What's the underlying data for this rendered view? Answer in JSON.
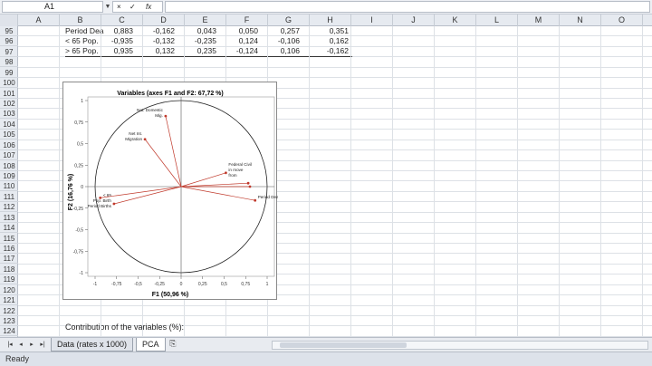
{
  "formula_bar": {
    "name_box": "A1",
    "name_dropdown_icon": "chevron-down-icon",
    "cancel_glyph": "×",
    "enter_glyph": "✓",
    "fx_label": "fx",
    "formula": ""
  },
  "columns": [
    "A",
    "B",
    "C",
    "D",
    "E",
    "F",
    "G",
    "H",
    "I",
    "J",
    "K",
    "L",
    "M",
    "N",
    "O"
  ],
  "rows": [
    "95",
    "96",
    "97",
    "98",
    "99",
    "100",
    "101",
    "102",
    "103",
    "104",
    "105",
    "106",
    "107",
    "108",
    "109",
    "110",
    "111",
    "112",
    "113",
    "114",
    "115",
    "116",
    "117",
    "118",
    "119",
    "120",
    "121",
    "122",
    "123",
    "124"
  ],
  "table": {
    "rows": [
      {
        "label": "Period Dea",
        "values": [
          "0,883",
          "-0,162",
          "0,043",
          "0,050",
          "0,257",
          "0,351"
        ]
      },
      {
        "label": "< 65 Pop.",
        "values": [
          "-0,935",
          "-0,132",
          "-0,235",
          "0,124",
          "-0,106",
          "0,162"
        ]
      },
      {
        "label": "> 65 Pop.",
        "values": [
          "0,935",
          "0,132",
          "0,235",
          "-0,124",
          "0,106",
          "-0,162"
        ]
      }
    ]
  },
  "contribution_label": "Contribution of the variables (%):",
  "sheets": {
    "nav_icons": [
      "first-sheet-icon",
      "prev-sheet-icon",
      "next-sheet-icon",
      "last-sheet-icon"
    ],
    "nav_glyphs": [
      "|◂",
      "◂",
      "▸",
      "▸|"
    ],
    "tabs": [
      "Data (rates x 1000)",
      "PCA"
    ],
    "active": "PCA",
    "add_sheet_glyph": "⎘"
  },
  "status": "Ready",
  "colors": {
    "vector": "#c0392b",
    "circle": "#222222",
    "header_bg": "#e6eaf0"
  },
  "chart_data": {
    "type": "scatter",
    "title": "Variables (axes F1 and F2: 67,72 %)",
    "xlabel": "F1 (50,96 %)",
    "ylabel": "F2 (16,76 %)",
    "xlim": [
      -1,
      1
    ],
    "ylim": [
      -1,
      1
    ],
    "x_ticks": [
      "-1",
      "-0,75",
      "-0,5",
      "-0,25",
      "0",
      "0,25",
      "0,5",
      "0,75",
      "1"
    ],
    "y_ticks": [
      "1",
      "0,75",
      "0,5",
      "0,25",
      "0",
      "-0,25",
      "-0,5",
      "-0,75",
      "-1"
    ],
    "correlation_circle": true,
    "vectors": [
      {
        "label": "Nat. Domestic Mig.",
        "x": -0.18,
        "y": 0.82
      },
      {
        "label": "Net Int. Migration",
        "x": -0.42,
        "y": 0.55
      },
      {
        "label": "Federal Civil in move from",
        "x": 0.52,
        "y": 0.16
      },
      {
        "label": "",
        "x": 0.78,
        "y": 0.04
      },
      {
        "label": "",
        "x": 0.8,
        "y": 0.0
      },
      {
        "label": "Period Deaths",
        "x": 0.86,
        "y": -0.16
      },
      {
        "label": "< 65 Pop. Birth Period Births",
        "x": -0.78,
        "y": -0.2
      },
      {
        "label": "",
        "x": -0.94,
        "y": -0.13
      }
    ]
  }
}
